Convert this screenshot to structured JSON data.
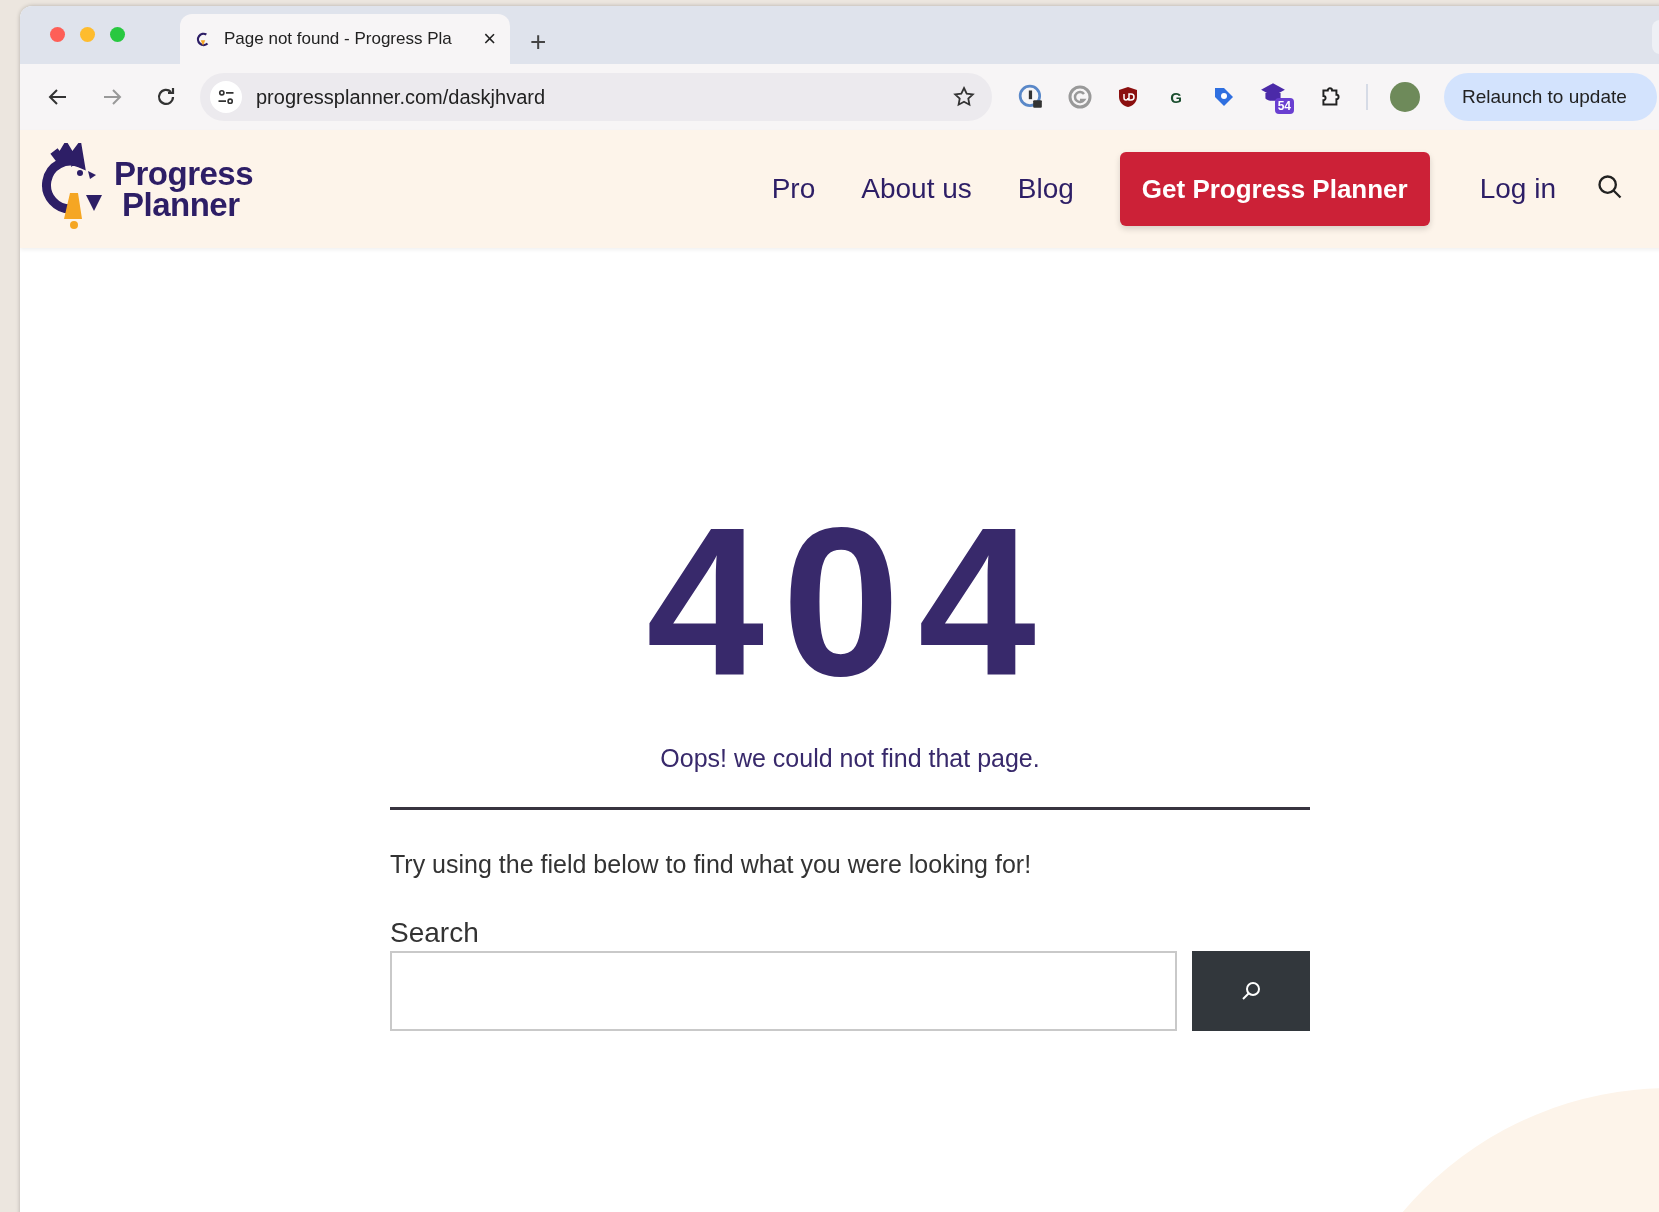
{
  "browser": {
    "tabs": [
      {
        "title": "Page not found - Progress Pla",
        "selected": true,
        "close": "×"
      }
    ],
    "new_tab": "+",
    "address": "progressplanner.com/daskjhvard",
    "extensions": [
      {
        "kind": "lock-circle"
      },
      {
        "kind": "grammar"
      },
      {
        "kind": "shield"
      },
      {
        "kind": "letter",
        "text": "G"
      },
      {
        "kind": "tag"
      },
      {
        "kind": "cap",
        "text": "54"
      },
      {
        "kind": "puzzle"
      }
    ],
    "relaunch": "Relaunch to update"
  },
  "site": {
    "logo": {
      "line_1": "Progress",
      "line_2": "Planner"
    },
    "nav": [
      {
        "label": "Pro"
      },
      {
        "label": "About us"
      },
      {
        "label": "Blog"
      }
    ],
    "cta": "Get Progress Planner",
    "login": "Log in"
  },
  "content": {
    "code": "404",
    "message": "Oops! we could not find that page.",
    "hint": "Try using the field below to find what you were looking for!",
    "search_label": "Search"
  }
}
